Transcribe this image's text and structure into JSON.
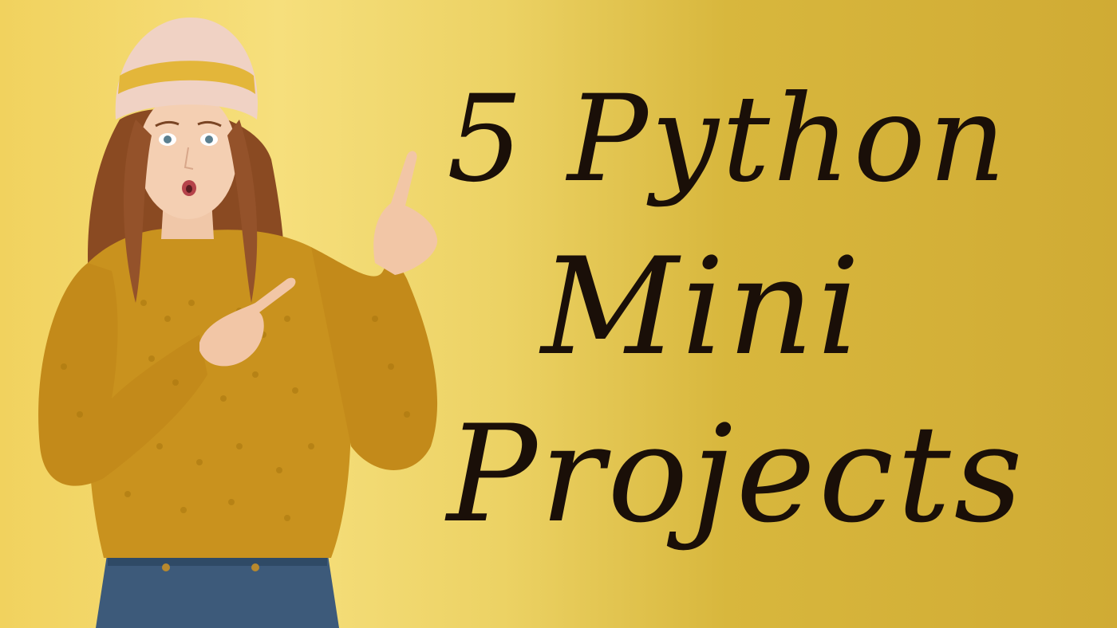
{
  "title": {
    "line1": "5 Python",
    "line2": "Mini",
    "line3": "Projects"
  },
  "colors": {
    "background_light": "#f6df7c",
    "background_dark": "#d0ab34",
    "sweater": "#c9921e",
    "hat": "#f0d2c4",
    "hat_stripe": "#e3b63a",
    "hair": "#8a4a22",
    "jeans": "#3d5a7a",
    "text": "#1a0f08"
  },
  "icons": [
    "woman-pointing-illustration"
  ]
}
